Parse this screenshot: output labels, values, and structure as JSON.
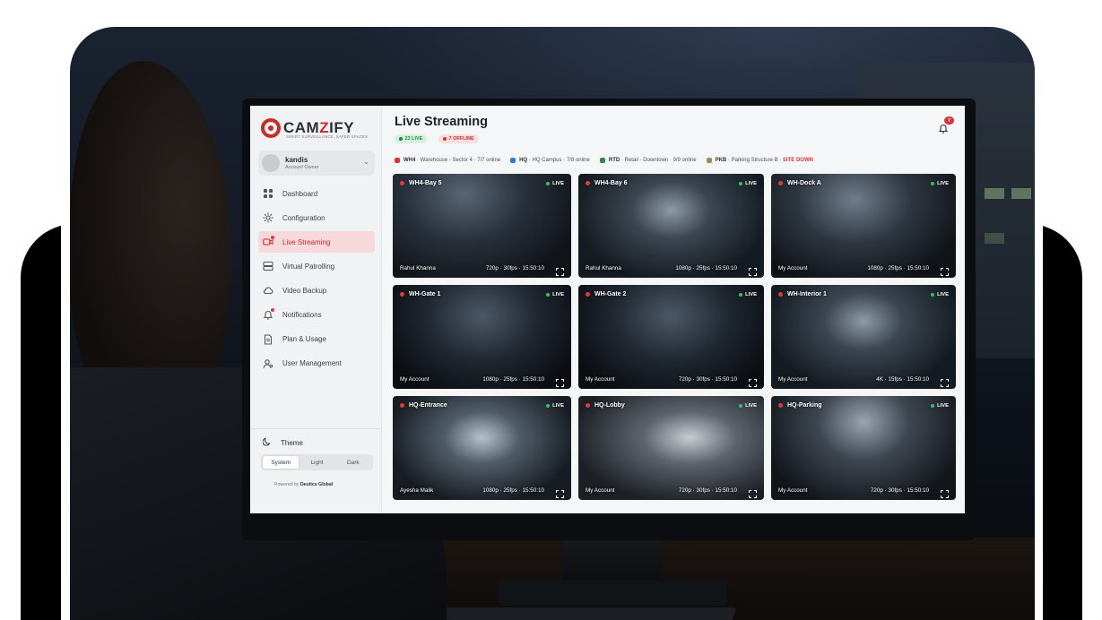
{
  "brand": {
    "logo_prefix": "CAM",
    "logo_z": "Z",
    "logo_suffix": "IFY",
    "tagline": "SMART SURVEILLANCE, SAFER SPACES",
    "accent_color": "#c92b2b"
  },
  "account": {
    "name": "kandis",
    "role": "Account Owner"
  },
  "nav": [
    {
      "label": "Dashboard",
      "icon": "grid-icon",
      "active": false
    },
    {
      "label": "Configuration",
      "icon": "gear-icon",
      "active": false
    },
    {
      "label": "Live Streaming",
      "icon": "video-icon",
      "active": true
    },
    {
      "label": "Virtual Patrolling",
      "icon": "server-icon",
      "active": false
    },
    {
      "label": "Video Backup",
      "icon": "cloud-icon",
      "active": false
    },
    {
      "label": "Notifications",
      "icon": "bell-icon",
      "active": false
    },
    {
      "label": "Plan & Usage",
      "icon": "document-icon",
      "active": false
    },
    {
      "label": "User Management",
      "icon": "users-icon",
      "active": false
    }
  ],
  "theme": {
    "title": "Theme",
    "options": [
      "System",
      "Light",
      "Dark"
    ],
    "selected": "System"
  },
  "powered": {
    "prefix": "Powered by",
    "company": "Deutics Global"
  },
  "header": {
    "title": "Live Streaming",
    "live_count": "23 LIVE",
    "offline_count": "7 OFFLINE",
    "notification_count": "7"
  },
  "sites": [
    {
      "code": "WH4",
      "text": " · Warehouse - Sector 4 · 7/7 online",
      "color": "#d43636",
      "status": ""
    },
    {
      "code": "HQ",
      "text": " · HQ Campus · 7/8 online",
      "color": "#2f7ad6",
      "status": ""
    },
    {
      "code": "RTD",
      "text": " · Retail - Downtown · 9/9 online",
      "color": "#2f8a4a",
      "status": ""
    },
    {
      "code": "PKB",
      "text": " · Parking Structure B · ",
      "color": "#9c8b5a",
      "status": "SITE DOWN"
    }
  ],
  "cameras": [
    {
      "name": "WH4-Bay 5",
      "status": "LIVE",
      "owner": "Rahul Khanna",
      "meta": "720p · 30fps · 15:50:10",
      "scene": "warehouse-exterior"
    },
    {
      "name": "WH4-Bay 6",
      "status": "LIVE",
      "owner": "Rahul Khanna",
      "meta": "1080p · 25fps · 15:50:10",
      "scene": "warehouse-aisle"
    },
    {
      "name": "WH-Dock A",
      "status": "LIVE",
      "owner": "My Account",
      "meta": "1080p · 25fps · 15:50:10",
      "scene": "loading-dock"
    },
    {
      "name": "WH-Gate 1",
      "status": "LIVE",
      "owner": "My Account",
      "meta": "1080p · 25fps · 15:50:10",
      "scene": "gate"
    },
    {
      "name": "WH-Gate 2",
      "status": "LIVE",
      "owner": "My Account",
      "meta": "720p · 30fps · 15:50:10",
      "scene": "gate"
    },
    {
      "name": "WH-Interior 1",
      "status": "LIVE",
      "owner": "My Account",
      "meta": "4K · 15fps · 15:50:10",
      "scene": "warehouse-aisle"
    },
    {
      "name": "HQ-Entrance",
      "status": "LIVE",
      "owner": "Ayesha Malik",
      "meta": "1080p · 25fps · 15:50:10",
      "scene": "entrance"
    },
    {
      "name": "HQ-Lobby",
      "status": "LIVE",
      "owner": "My Account",
      "meta": "720p · 30fps · 15:50:10",
      "scene": "lobby"
    },
    {
      "name": "HQ-Parking",
      "status": "LIVE",
      "owner": "My Account",
      "meta": "720p · 30fps · 15:50:10",
      "scene": "parking"
    }
  ]
}
